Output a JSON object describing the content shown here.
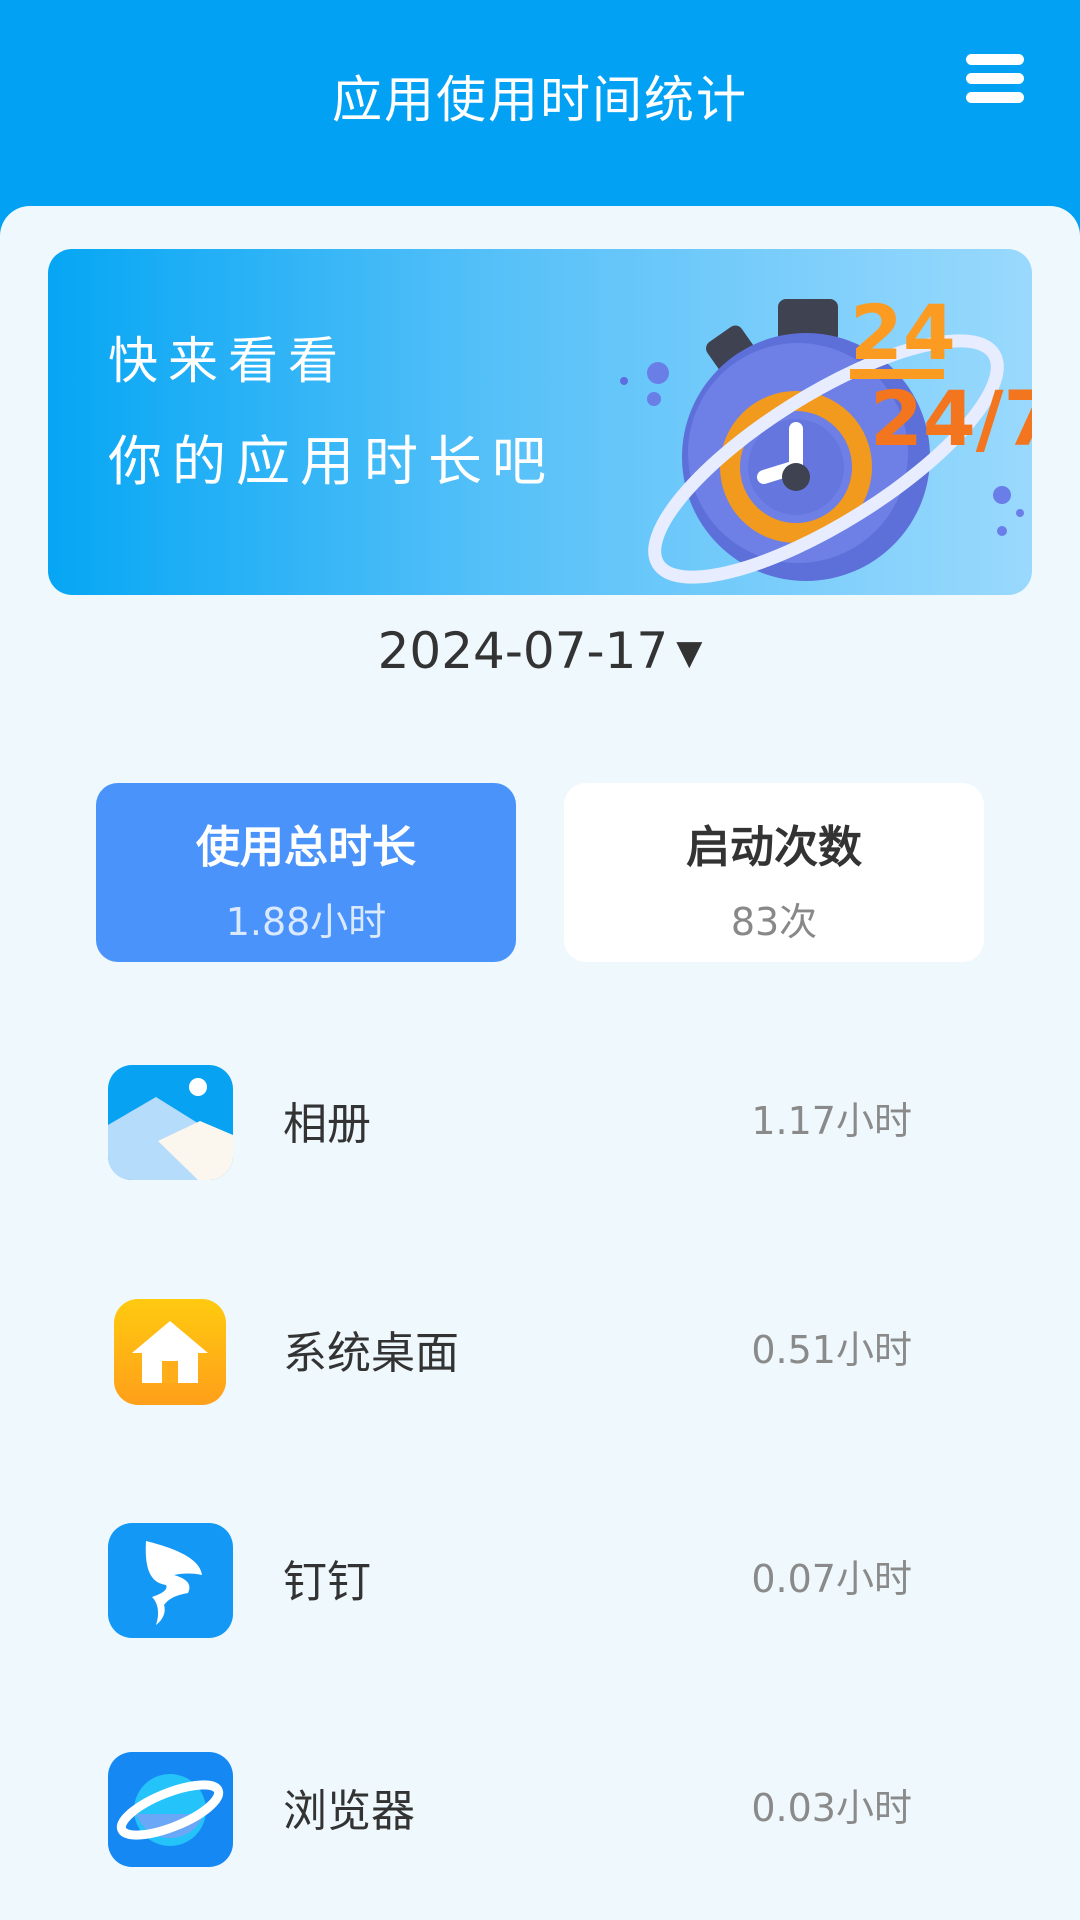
{
  "header": {
    "title": "应用使用时间统计",
    "menu_icon": "hamburger-menu-icon"
  },
  "banner": {
    "line1": "快来看看",
    "line2": "你的应用时长吧",
    "illustration": "stopwatch-24-7-illustration",
    "illustration_text": "24/7"
  },
  "date_selector": {
    "value": "2024-07-17",
    "arrow": "▼"
  },
  "stats": {
    "total_duration": {
      "label": "使用总时长",
      "value": "1.88小时"
    },
    "launch_count": {
      "label": "启动次数",
      "value": "83次"
    }
  },
  "apps": [
    {
      "name": "相册",
      "time": "1.17小时",
      "icon": "gallery-icon"
    },
    {
      "name": "系统桌面",
      "time": "0.51小时",
      "icon": "home-icon"
    },
    {
      "name": "钉钉",
      "time": "0.07小时",
      "icon": "dingtalk-icon"
    },
    {
      "name": "浏览器",
      "time": "0.03小时",
      "icon": "browser-icon"
    }
  ],
  "colors": {
    "primary": "#03a1f3",
    "background": "#eef8fd",
    "active_card": "#4a93fb",
    "text_dark": "#333333",
    "text_muted": "#8a8a8a"
  }
}
